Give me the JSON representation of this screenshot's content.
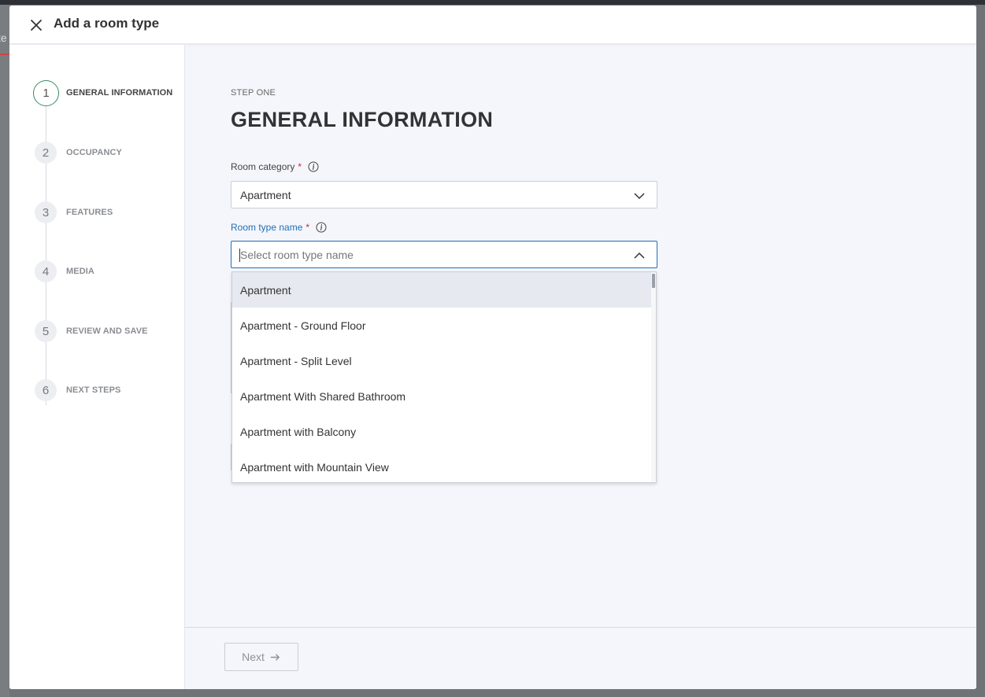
{
  "backdrop": {
    "fragment": "te"
  },
  "header": {
    "title": "Add a room type",
    "close_icon": "close-icon"
  },
  "steps": [
    {
      "number": "1",
      "label": "GENERAL INFORMATION",
      "active": true
    },
    {
      "number": "2",
      "label": "OCCUPANCY",
      "active": false
    },
    {
      "number": "3",
      "label": "FEATURES",
      "active": false
    },
    {
      "number": "4",
      "label": "MEDIA",
      "active": false
    },
    {
      "number": "5",
      "label": "REVIEW AND SAVE",
      "active": false
    },
    {
      "number": "6",
      "label": "NEXT STEPS",
      "active": false
    }
  ],
  "main": {
    "kicker": "STEP ONE",
    "title": "GENERAL INFORMATION",
    "room_category": {
      "label": "Room category",
      "required": "*",
      "value": "Apartment"
    },
    "room_type_name": {
      "label": "Room type name",
      "required": "*",
      "value": "",
      "placeholder": "Select room type name"
    },
    "dropdown_options": [
      "Apartment",
      "Apartment - Ground Floor",
      "Apartment - Split Level",
      "Apartment With Shared Bathroom",
      "Apartment with Balcony",
      "Apartment with Mountain View"
    ],
    "highlighted_option": "Apartment"
  },
  "footer": {
    "next_label": "Next"
  },
  "colors": {
    "accent": "#1e6fb8",
    "required": "#c5283d",
    "active_step_border": "#3a8a64"
  }
}
